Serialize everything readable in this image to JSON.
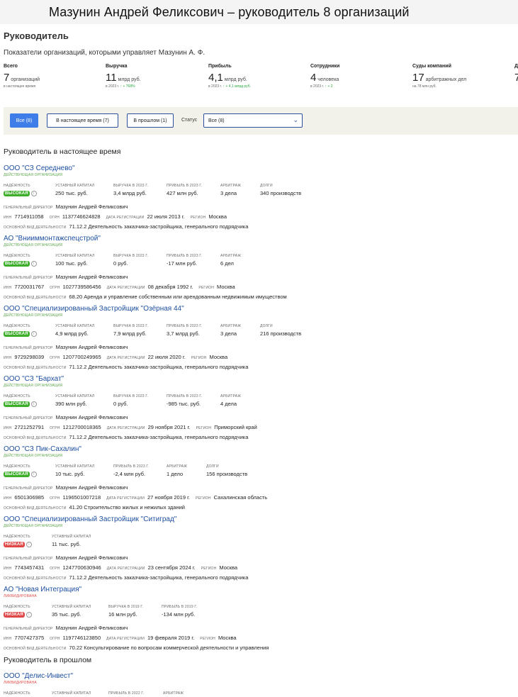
{
  "page_title": "Мазунин Андрей Феликсович – руководитель 8 организаций",
  "heading": "Руководитель",
  "subtitle": "Показатели организаций, которыми управляет Мазунин А. Ф.",
  "stats": [
    {
      "label": "Всего",
      "value": "7",
      "unit": "организаций",
      "note": "в настоящее время",
      "delta": ""
    },
    {
      "label": "Выручка",
      "value": "11",
      "unit": "млрд руб.",
      "note": "в 2023 г.",
      "delta": "↑ + 768%"
    },
    {
      "label": "Прибыль",
      "value": "4,1",
      "unit": "млрд руб.",
      "note": "в 2023 г.",
      "delta": "↑ + 4,1 млрд руб."
    },
    {
      "label": "Сотрудники",
      "value": "4",
      "unit": "человека",
      "note": "в 2023 г.",
      "delta": "↑ + 2"
    },
    {
      "label": "Суды компаний",
      "value": "17",
      "unit": "арбитражных дел",
      "note": "на 78 млн руб.",
      "delta": ""
    },
    {
      "label": "Д",
      "value": "7",
      "unit": "",
      "note": "",
      "delta": ""
    }
  ],
  "filters": {
    "all": "Все (8)",
    "current": "В настоящее время (7)",
    "past": "В прошлом (1)",
    "status_label": "Статус",
    "status_value": "Все (8)"
  },
  "section_current": "Руководитель в настоящее время",
  "section_past": "Руководитель в прошлом",
  "labels": {
    "reliability": "НАДЁЖНОСТЬ",
    "capital": "УСТАВНЫЙ КАПИТАЛ",
    "arbitration": "АРБИТРАЖ",
    "debts": "ДОЛГИ",
    "director": "ГЕНЕРАЛЬНЫЙ ДИРЕКТОР",
    "inn": "ИНН",
    "ogrn": "ОГРН",
    "reg_date": "ДАТА РЕГИСТРАЦИИ",
    "region": "РЕГИОН",
    "activity": "ОСНОВНОЙ ВИД ДЕЯТЕЛЬНОСТИ"
  },
  "orgs": [
    {
      "name": "ООО \"СЗ Середнево\"",
      "status": "ДЕЙСТВУЮЩАЯ ОРГАНИЗАЦИЯ",
      "badge": "ВЫСОКАЯ",
      "capital": "250 тыс. руб.",
      "revenue_label": "ВЫРУЧКА В 2023 Г.",
      "revenue": "3,4 млрд руб.",
      "profit_label": "ПРИБЫЛЬ В 2023 Г.",
      "profit": "427 млн руб.",
      "arbitration": "3 дела",
      "debts": "340 производств",
      "director": "Мазунин Андрей Феликсович",
      "inn": "7714911058",
      "ogrn": "1137746624828",
      "reg_date": "22 июля 2013 г.",
      "region": "Москва",
      "activity": "71.12.2 Деятельность заказчика-застройщика, генерального подрядчика"
    },
    {
      "name": "АО \"Внииммонтажспецстрой\"",
      "status": "ДЕЙСТВУЮЩАЯ ОРГАНИЗАЦИЯ",
      "badge": "ВЫСОКАЯ",
      "capital": "100 тыс. руб.",
      "revenue_label": "ВЫРУЧКА В 2023 Г.",
      "revenue": "0 руб.",
      "profit_label": "ПРИБЫЛЬ В 2023 Г.",
      "profit": "-17 млн руб.",
      "arbitration": "6 дел",
      "debts": "",
      "director": "Мазунин Андрей Феликсович",
      "inn": "7720031767",
      "ogrn": "1027739586456",
      "reg_date": "08 декабря 1992 г.",
      "region": "Москва",
      "activity": "68.20 Аренда и управление собственным или арендованным недвижимым имуществом"
    },
    {
      "name": "ООО \"Специализированный Застройщик \"Озёрная 44\"",
      "status": "ДЕЙСТВУЮЩАЯ ОРГАНИЗАЦИЯ",
      "badge": "ВЫСОКАЯ",
      "capital": "4,9 млрд руб.",
      "revenue_label": "ВЫРУЧКА В 2023 Г.",
      "revenue": "7,9 млрд руб.",
      "profit_label": "ПРИБЫЛЬ В 2023 Г.",
      "profit": "3,7 млрд руб.",
      "arbitration": "3 дела",
      "debts": "216 производств",
      "director": "Мазунин Андрей Феликсович",
      "inn": "9729298039",
      "ogrn": "1207700249965",
      "reg_date": "22 июля 2020 г.",
      "region": "Москва",
      "activity": "71.12.2 Деятельность заказчика-застройщика, генерального подрядчика"
    },
    {
      "name": "ООО \"СЗ \"Бархат\"",
      "status": "ДЕЙСТВУЮЩАЯ ОРГАНИЗАЦИЯ",
      "badge": "ВЫСОКАЯ",
      "capital": "390 млн руб.",
      "revenue_label": "ВЫРУЧКА В 2023 Г.",
      "revenue": "0 руб.",
      "profit_label": "ПРИБЫЛЬ В 2023 Г.",
      "profit": "-985 тыс. руб.",
      "arbitration": "4 дела",
      "debts": "",
      "director": "Мазунин Андрей Феликсович",
      "inn": "2721252791",
      "ogrn": "1212700018365",
      "reg_date": "29 ноября 2021 г.",
      "region": "Приморский край",
      "activity": "71.12.2 Деятельность заказчика-застройщика, генерального подрядчика"
    },
    {
      "name": "ООО \"СЗ Пик-Сахалин\"",
      "status": "ДЕЙСТВУЮЩАЯ ОРГАНИЗАЦИЯ",
      "badge": "ВЫСОКАЯ",
      "capital": "10 тыс. руб.",
      "revenue_label": "",
      "revenue": "",
      "profit_label": "ПРИБЫЛЬ В 2023 Г.",
      "profit": "-2,4 млн руб.",
      "arbitration": "1 дело",
      "debts": "156 производств",
      "director": "Мазунин Андрей Феликсович",
      "inn": "6501306985",
      "ogrn": "1196501007218",
      "reg_date": "27 ноября 2019 г.",
      "region": "Сахалинская область",
      "activity": "41.20 Строительство жилых и нежилых зданий"
    },
    {
      "name": "ООО \"Специализированный Застройщик \"Ситиград\"",
      "status": "ДЕЙСТВУЮЩАЯ ОРГАНИЗАЦИЯ",
      "badge": "НИЗКАЯ",
      "capital": "11 тыс. руб.",
      "revenue_label": "",
      "revenue": "",
      "profit_label": "",
      "profit": "",
      "arbitration": "",
      "debts": "",
      "director": "Мазунин Андрей Феликсович",
      "inn": "7743457431",
      "ogrn": "1247700630946",
      "reg_date": "23 сентября 2024 г.",
      "region": "Москва",
      "activity": "71.12.2 Деятельность заказчика-застройщика, генерального подрядчика"
    },
    {
      "name": "АО \"Новая Интеграция\"",
      "status": "ЛИКВИДИРОВАНА",
      "badge": "НИЗКАЯ",
      "capital": "35 тыс. руб.",
      "revenue_label": "ВЫРУЧКА В 2019 Г.",
      "revenue": "16 млн руб.",
      "profit_label": "ПРИБЫЛЬ В 2019 Г.",
      "profit": "-134 млн руб.",
      "arbitration": "",
      "debts": "",
      "director": "Мазунин Андрей Феликсович",
      "inn": "7707427375",
      "ogrn": "1197746123850",
      "reg_date": "19 февраля 2019 г.",
      "region": "Москва",
      "activity": "70.22 Консультирование по вопросам коммерческой деятельности и управления"
    }
  ],
  "past_org": {
    "name": "ООО \"Делис-Инвест\"",
    "status": "ЛИКВИДИРОВАНА",
    "profit_label": "ПРИБЫЛЬ В 2022 Г."
  },
  "colors": {
    "link": "#1d4fa0",
    "accent": "#3f7de8",
    "high": "#3cae2a",
    "low": "#e04848"
  }
}
